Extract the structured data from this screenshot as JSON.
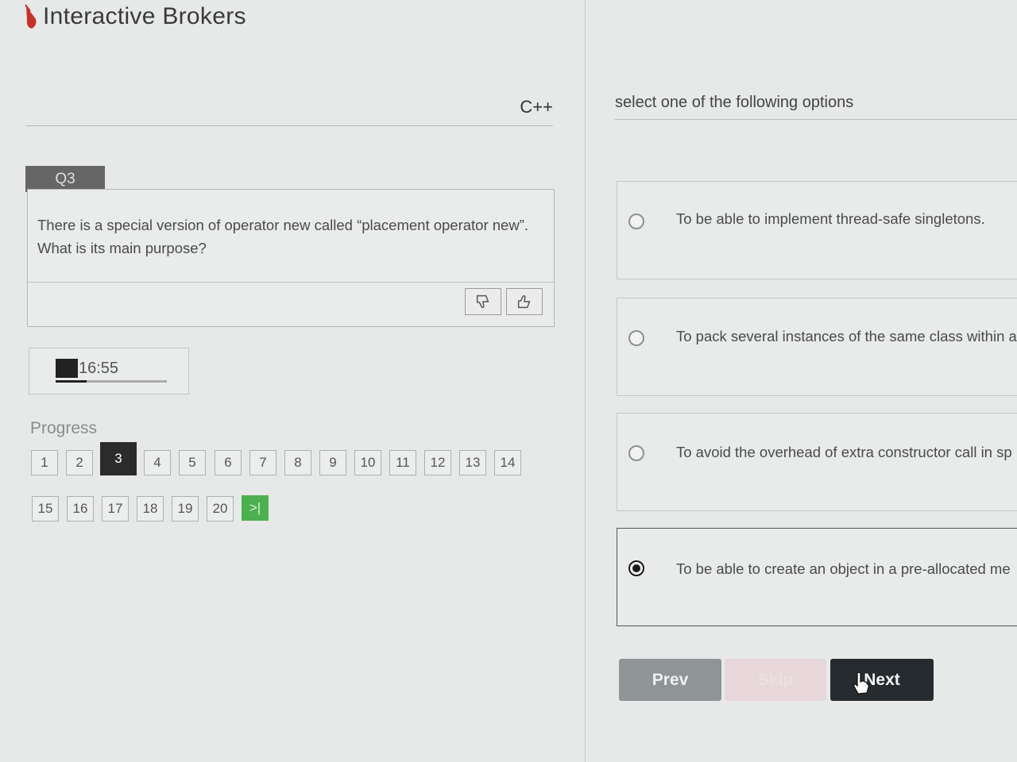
{
  "header": {
    "brand": "Interactive Brokers",
    "brand_color": "#d0342c"
  },
  "question_panel": {
    "language": "C++",
    "question_tag": "Q3",
    "question_text_line1": "There is a special version of operator new called “placement operator new”.",
    "question_text_line2": "What is its main purpose?",
    "dislike_icon": "thumbs-down-icon",
    "like_icon": "thumbs-up-icon"
  },
  "timer": {
    "time": "16:55",
    "progress_fraction": 0.28
  },
  "progress": {
    "label": "Progress",
    "pages_row1": [
      "1",
      "2",
      "3",
      "4",
      "5",
      "6",
      "7",
      "8",
      "9",
      "10",
      "11",
      "12",
      "13",
      "14"
    ],
    "pages_row2": [
      "15",
      "16",
      "17",
      "18",
      "19",
      "20"
    ],
    "current_page": "3",
    "last_page_label": ">|"
  },
  "answers": {
    "instruction": "select one of the following options",
    "options": [
      {
        "text": "To be able to implement thread-safe singletons.",
        "selected": false
      },
      {
        "text": "To pack several instances of the same class within a",
        "selected": false
      },
      {
        "text": "To avoid the overhead of extra constructor call in sp",
        "selected": false
      },
      {
        "text": "To be able to create an object in a pre-allocated me",
        "selected": true
      }
    ]
  },
  "nav": {
    "prev_label": "Prev",
    "skip_label": "Skip",
    "next_label": "Next"
  }
}
